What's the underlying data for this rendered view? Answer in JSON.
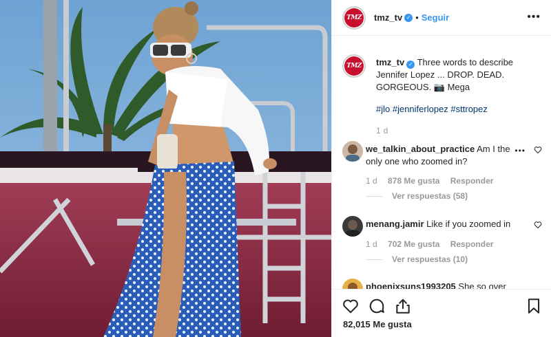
{
  "post": {
    "username": "tmz_tv",
    "follow_label": "Seguir",
    "separator": "•",
    "more_label": "•••",
    "avatar_logo": "TMZ",
    "caption": "Three words to describe Jennifer Lopez ... DROP. DEAD. GORGEOUS. 📷 Mega",
    "hashtags": "#jlo #jenniferlopez #sttropez",
    "time_ago": "1 d",
    "likes": "82,015 Me gusta"
  },
  "comments": [
    {
      "username": "we_talkin_about_practice",
      "text": "Am I the only one who zoomed in?",
      "time": "1 d",
      "likes": "878 Me gusta",
      "reply": "Responder",
      "view_replies": "Ver respuestas (58)"
    },
    {
      "username": "menang.jamir",
      "text": "Like if you zoomed in",
      "time": "1 d",
      "likes": "702 Me gusta",
      "reply": "Responder",
      "view_replies": "Ver respuestas (10)"
    },
    {
      "username": "phoenixsuns1993205",
      "text": "She so over"
    }
  ],
  "icons": {
    "verified": "verified-badge-icon",
    "heart": "heart-icon",
    "comment": "comment-icon",
    "share": "share-icon",
    "bookmark": "bookmark-icon"
  },
  "colors": {
    "accent": "#3897f0",
    "hashtag": "#003569",
    "brand_red": "#c8102e",
    "muted": "#999999"
  }
}
